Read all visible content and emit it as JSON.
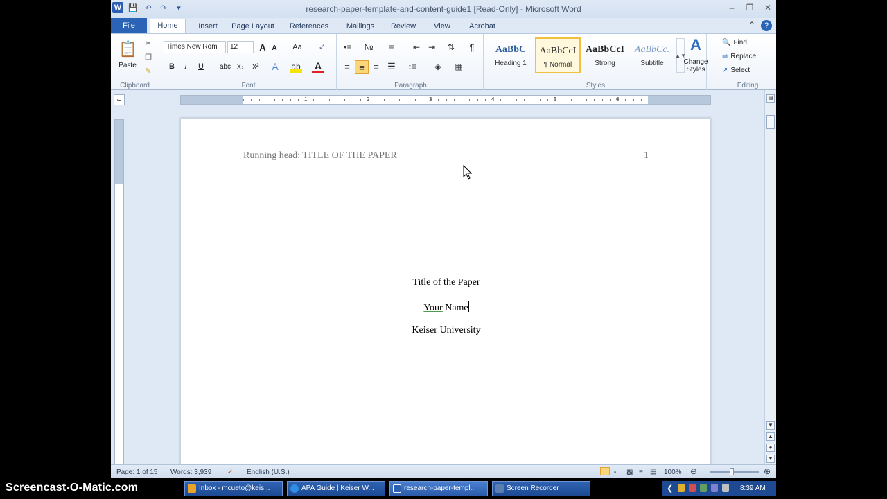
{
  "window": {
    "title": "research-paper-template-and-content-guide1 [Read-Only] - Microsoft Word",
    "app_icon": "W"
  },
  "quick_access": [
    "save-icon",
    "undo-icon",
    "redo-icon",
    "customize-icon"
  ],
  "tabs": [
    "File",
    "Home",
    "Insert",
    "Page Layout",
    "References",
    "Mailings",
    "Review",
    "View",
    "Acrobat"
  ],
  "ribbon": {
    "clipboard": {
      "label": "Clipboard",
      "paste": "Paste"
    },
    "font": {
      "label": "Font",
      "name": "Times New Rom",
      "size": "12",
      "bold": "B",
      "italic": "I",
      "underline": "U",
      "strike": "abc",
      "sub": "x₂",
      "sup": "x²",
      "grow": "A",
      "shrink": "A",
      "case": "Aa"
    },
    "paragraph": {
      "label": "Paragraph"
    },
    "styles": {
      "label": "Styles",
      "items": [
        {
          "sample": "AaBbC",
          "name": "Heading 1"
        },
        {
          "sample": "AaBbCcI",
          "name": "¶ Normal"
        },
        {
          "sample": "AaBbCcI",
          "name": "Strong"
        },
        {
          "sample": "AaBbCc.",
          "name": "Subtitle"
        }
      ],
      "change": "Change Styles"
    },
    "editing": {
      "label": "Editing",
      "find": "Find",
      "replace": "Replace",
      "select": "Select"
    }
  },
  "ruler": {
    "numbers": [
      "1",
      "2",
      "3",
      "4",
      "5",
      "6"
    ]
  },
  "document": {
    "running_head": "Running head: TITLE OF THE PAPER",
    "page_number": "1",
    "title": "Title of the Paper",
    "author_first": "Your",
    "author_last": " Name",
    "institution": "Keiser University"
  },
  "status": {
    "page": "Page: 1 of 15",
    "words": "Words: 3,939",
    "language": "English (U.S.)",
    "zoom": "100%",
    "zoom_level": 100
  },
  "taskbar": {
    "watermark": "Screencast-O-Matic.com",
    "items": [
      {
        "label": "Inbox - mcueto@keis...",
        "color": "#e8a52a"
      },
      {
        "label": "APA Guide | Keiser W...",
        "color": "#2f8de4"
      },
      {
        "label": "research-paper-templ...",
        "color": "#2b5fb4"
      },
      {
        "label": "Screen Recorder",
        "color": "#5a7fb0"
      }
    ],
    "clock": "8:39 AM"
  }
}
